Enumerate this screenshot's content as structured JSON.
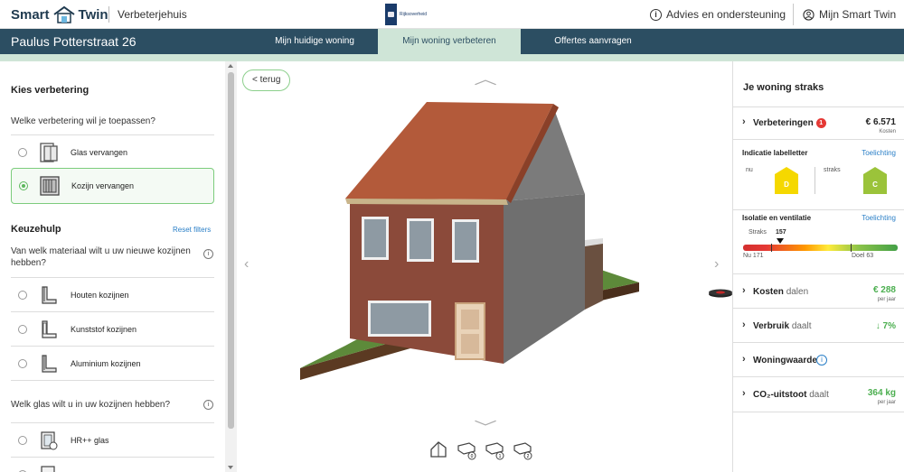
{
  "header": {
    "logo_left": "Smart",
    "logo_right": "Twin",
    "app_name": "Verbeterjehuis",
    "gov_label": "Rijksoverheid",
    "advies_label": "Advies en ondersteuning",
    "account_label": "Mijn Smart Twin"
  },
  "nav": {
    "address": "Paulus Potterstraat 26",
    "tabs": [
      {
        "label": "Mijn huidige woning"
      },
      {
        "label": "Mijn woning verbeteren"
      },
      {
        "label": "Offertes aanvragen"
      }
    ]
  },
  "left": {
    "title": "Kies verbetering",
    "question1": "Welke verbetering wil je toepassen?",
    "improvements": [
      {
        "label": "Glas vervangen",
        "icon": "window-pane-icon",
        "selected": false
      },
      {
        "label": "Kozijn vervangen",
        "icon": "window-frame-icon",
        "selected": true
      }
    ],
    "keuzehulp_title": "Keuzehulp",
    "reset_label": "Reset filters",
    "question2": "Van welk materiaal wilt u uw nieuwe kozijnen hebben?",
    "materials": [
      {
        "label": "Houten kozijnen",
        "icon": "wood-frame-icon"
      },
      {
        "label": "Kunststof kozijnen",
        "icon": "plastic-frame-icon"
      },
      {
        "label": "Aluminium kozijnen",
        "icon": "aluminium-frame-icon"
      }
    ],
    "question3": "Welk glas wilt u in uw kozijnen hebben?",
    "glass": [
      {
        "label": "HR++ glas",
        "icon": "glass-icon"
      }
    ]
  },
  "center": {
    "back_label": "< terug"
  },
  "right": {
    "title": "Je woning straks",
    "verbeteringen": {
      "label": "Verbeteringen",
      "count": "1",
      "value": "€ 6.571",
      "sub": "Kosten"
    },
    "labelletter": {
      "title": "Indicatie labelletter",
      "link": "Toelichting",
      "nu_label": "nu",
      "nu_value": "D",
      "straks_label": "straks",
      "straks_value": "C",
      "colors": {
        "D": "#f5d800",
        "C": "#9bc33a"
      }
    },
    "isolatie": {
      "title": "Isolatie en ventilatie",
      "link": "Toelichting",
      "straks_label": "Straks",
      "straks_value": "157",
      "nu_text": "Nu 171",
      "doel_text": "Doel 63"
    },
    "kosten": {
      "label": "Kosten",
      "trend": "dalen",
      "value": "€ 288",
      "sub": "per jaar"
    },
    "verbruik": {
      "label": "Verbruik",
      "trend": "daalt",
      "value": "7%"
    },
    "woningwaarde": {
      "label": "Woningwaarde"
    },
    "co2": {
      "label": "CO₂-uitstoot",
      "trend": "daalt",
      "value": "364 kg",
      "sub": "per jaar"
    }
  }
}
